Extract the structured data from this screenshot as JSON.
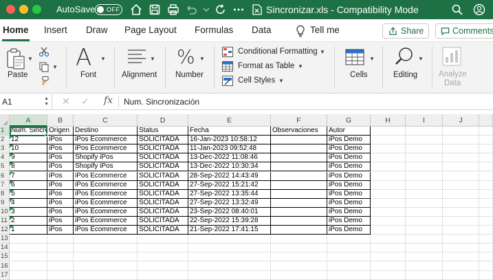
{
  "titlebar": {
    "autosave_label": "AutoSave",
    "autosave_state": "OFF",
    "document_title": "Sincronizar.xls  -  Compatibility Mode"
  },
  "tabs": [
    {
      "label": "Home",
      "active": true
    },
    {
      "label": "Insert"
    },
    {
      "label": "Draw"
    },
    {
      "label": "Page Layout"
    },
    {
      "label": "Formulas"
    },
    {
      "label": "Data"
    },
    {
      "label": "Tell me"
    }
  ],
  "share_label": "Share",
  "comments_label": "Comments",
  "ribbon": {
    "paste": "Paste",
    "font": "Font",
    "alignment": "Alignment",
    "number": "Number",
    "conditional_formatting": "Conditional Formatting",
    "format_as_table": "Format as Table",
    "cell_styles": "Cell Styles",
    "cells": "Cells",
    "editing": "Editing",
    "analyze_data_line1": "Analyze",
    "analyze_data_line2": "Data",
    "font_glyph": "A",
    "number_glyph": "%"
  },
  "formula_bar": {
    "cell_ref": "A1",
    "cancel_symbol": "✕",
    "confirm_symbol": "✓",
    "fx_symbol": "fx",
    "value": "Num. Sincronización"
  },
  "columns": [
    "A",
    "B",
    "C",
    "D",
    "E",
    "F",
    "G",
    "H",
    "I",
    "J"
  ],
  "row_numbers": [
    "1",
    "2",
    "3",
    "4",
    "5",
    "6",
    "7",
    "8",
    "9",
    "10",
    "11",
    "12",
    "13",
    "14",
    "15",
    "16",
    "17"
  ],
  "headers": [
    "Num. Sincronización",
    "Origen",
    "Destino",
    "Status",
    "Fecha",
    "Observaciones",
    "Autor"
  ],
  "rows": [
    [
      "12",
      "iPos",
      "iPos Ecommerce",
      "SOLICITADA",
      "16-Jan-2023 10:58:12",
      "",
      "iPos Demo"
    ],
    [
      "10",
      "iPos",
      "iPos Ecommerce",
      "SOLICITADA",
      "11-Jan-2023 09:52:48",
      "",
      "iPos Demo"
    ],
    [
      "9",
      "iPos",
      "Shopify iPos",
      "SOLICITADA",
      "13-Dec-2022 11:08:46",
      "",
      "iPos Demo"
    ],
    [
      "8",
      "iPos",
      "Shopify iPos",
      "SOLICITADA",
      "13-Dec-2022 10:30:34",
      "",
      "iPos Demo"
    ],
    [
      "7",
      "iPos",
      "iPos Ecommerce",
      "SOLICITADA",
      "28-Sep-2022 14:43:49",
      "",
      "iPos Demo"
    ],
    [
      "6",
      "iPos",
      "iPos Ecommerce",
      "SOLICITADA",
      "27-Sep-2022 15:21:42",
      "",
      "iPos Demo"
    ],
    [
      "5",
      "iPos",
      "iPos Ecommerce",
      "SOLICITADA",
      "27-Sep-2022 13:35:44",
      "",
      "iPos Demo"
    ],
    [
      "4",
      "iPos",
      "iPos Ecommerce",
      "SOLICITADA",
      "27-Sep-2022 13:32:49",
      "",
      "iPos Demo"
    ],
    [
      "3",
      "iPos",
      "iPos Ecommerce",
      "SOLICITADA",
      "23-Sep-2022 08:40:01",
      "",
      "iPos Demo"
    ],
    [
      "2",
      "iPos",
      "iPos Ecommerce",
      "SOLICITADA",
      "22-Sep-2022 15:39:28",
      "",
      "iPos Demo"
    ],
    [
      "1",
      "iPos",
      "iPos Ecommerce",
      "SOLICITADA",
      "21-Sep-2022 17:41:15",
      "",
      "iPos Demo"
    ]
  ],
  "colors": {
    "accent": "#1e7145",
    "title_bar": "#1e7145",
    "number_as_text_marker": "#1e9a4a"
  }
}
